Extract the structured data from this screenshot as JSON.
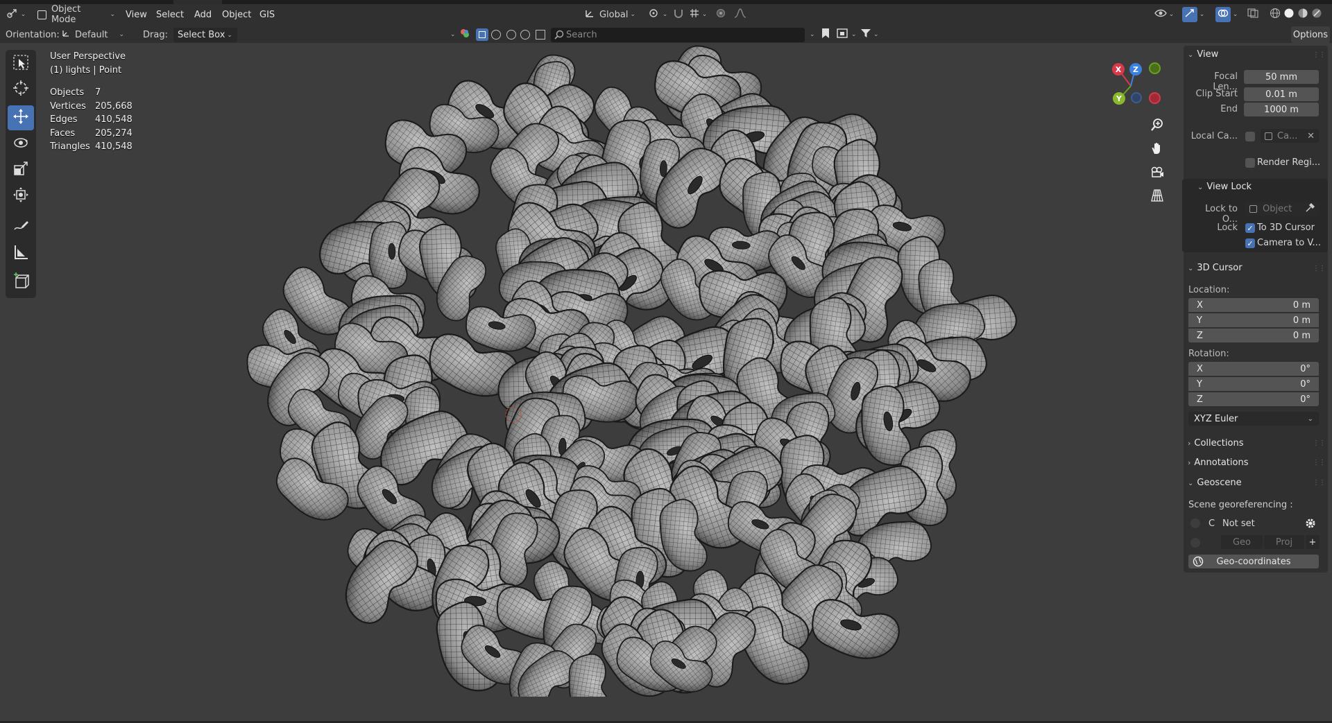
{
  "header": {
    "editor_type_icon": "3d-viewport-icon",
    "mode": "Object Mode",
    "menus": [
      "View",
      "Select",
      "Add",
      "Object",
      "GIS"
    ],
    "transform_orientation": "Global",
    "options_label": "Options"
  },
  "tool_header": {
    "orientation_label": "Orientation:",
    "orientation_value": "Default",
    "drag_label": "Drag:",
    "drag_value": "Select Box",
    "search_placeholder": "Search"
  },
  "toolbar": {
    "tools": [
      {
        "name": "select-box-tool",
        "icon": "select-box-icon"
      },
      {
        "name": "cursor-tool",
        "icon": "cursor-icon"
      },
      {
        "name": "move-tool",
        "icon": "move-icon",
        "active": true
      },
      {
        "name": "rotate-tool",
        "icon": "rotate-icon"
      },
      {
        "name": "scale-tool",
        "icon": "scale-icon"
      },
      {
        "name": "transform-tool",
        "icon": "transform-icon"
      },
      {
        "name": "annotate-tool",
        "icon": "annotate-icon"
      },
      {
        "name": "measure-tool",
        "icon": "measure-icon"
      },
      {
        "name": "add-cube-tool",
        "icon": "add-cube-icon"
      }
    ]
  },
  "viewport": {
    "perspective": "User Perspective",
    "collection_line": "(1) lights | Point",
    "stats": [
      {
        "label": "Objects",
        "value": "7"
      },
      {
        "label": "Vertices",
        "value": "205,668"
      },
      {
        "label": "Edges",
        "value": "410,548"
      },
      {
        "label": "Faces",
        "value": "205,274"
      },
      {
        "label": "Triangles",
        "value": "410,548"
      }
    ],
    "gizmo": {
      "x": "X",
      "y": "Y",
      "z": "Z"
    }
  },
  "sidebar": {
    "view": {
      "title": "View",
      "focal_length_label": "Focal Len...",
      "focal_length_value": "50 mm",
      "clip_start_label": "Clip Start",
      "clip_start_value": "0.01 m",
      "end_label": "End",
      "end_value": "1000 m",
      "local_camera_label": "Local Ca...",
      "local_camera_value": "Ca...",
      "render_region_label": "Render Regi..."
    },
    "view_lock": {
      "title": "View Lock",
      "lock_to_object_label": "Lock to O...",
      "lock_to_object_placeholder": "Object",
      "lock_label": "Lock",
      "to_3d_cursor": "To 3D Cursor",
      "camera_to_view": "Camera to V..."
    },
    "cursor": {
      "title": "3D Cursor",
      "location_label": "Location:",
      "location": [
        {
          "axis": "X",
          "value": "0 m"
        },
        {
          "axis": "Y",
          "value": "0 m"
        },
        {
          "axis": "Z",
          "value": "0 m"
        }
      ],
      "rotation_label": "Rotation:",
      "rotation": [
        {
          "axis": "X",
          "value": "0°"
        },
        {
          "axis": "Y",
          "value": "0°"
        },
        {
          "axis": "Z",
          "value": "0°"
        }
      ],
      "rotation_mode": "XYZ Euler"
    },
    "collections": "Collections",
    "annotations": "Annotations",
    "geoscene": {
      "title": "Geoscene",
      "georef_label": "Scene georeferencing :",
      "crs_letter": "C",
      "crs_value": "Not set",
      "geo_btn": "Geo",
      "proj_btn": "Proj",
      "geocoords_btn": "Geo-coordinates"
    }
  },
  "colors": {
    "accent": "#4772b3",
    "background": "#3d3d3d",
    "header": "#303030",
    "x_axis": "#d7394a",
    "y_axis": "#6ca01c",
    "z_axis": "#3b82e0"
  }
}
